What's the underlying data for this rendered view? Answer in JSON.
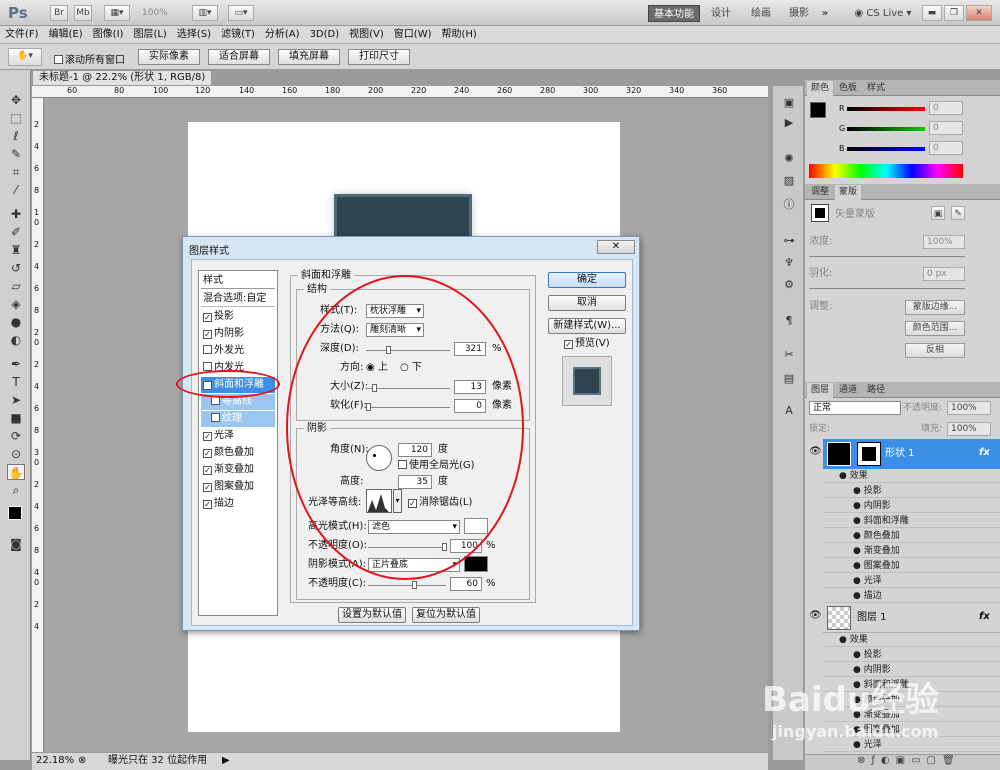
{
  "app": {
    "logo": "Ps",
    "zoom_box": "100%"
  },
  "workspace": {
    "items": [
      "基本功能",
      "设计",
      "绘画",
      "摄影"
    ],
    "more": "»",
    "cslive": "CS Live"
  },
  "menu": [
    "文件(F)",
    "编辑(E)",
    "图像(I)",
    "图层(L)",
    "选择(S)",
    "滤镜(T)",
    "分析(A)",
    "3D(D)",
    "视图(V)",
    "窗口(W)",
    "帮助(H)"
  ],
  "options": {
    "scroll_all": "滚动所有窗口",
    "buttons": [
      "实际像素",
      "适合屏幕",
      "填充屏幕",
      "打印尺寸"
    ]
  },
  "document": {
    "tab": "未标题-1 @ 22.2% (形状 1, RGB/8) *",
    "ruler_h": [
      "60",
      "80",
      "100",
      "120",
      "140",
      "160",
      "180",
      "200",
      "220",
      "240",
      "260",
      "280",
      "300",
      "320",
      "340",
      "360"
    ],
    "ruler_v": [
      "2",
      "4",
      "6",
      "8",
      "1",
      "0",
      "2",
      "4",
      "6",
      "8",
      "2",
      "0",
      "2",
      "4",
      "6",
      "8",
      "3",
      "0",
      "2",
      "4",
      "6",
      "8",
      "4",
      "0",
      "2",
      "4"
    ]
  },
  "status": {
    "zoom": "22.18%",
    "msg": "曝光只在 32 位起作用"
  },
  "color_panel": {
    "tabs": [
      "颜色",
      "色板",
      "样式"
    ],
    "labels": [
      "R",
      "G",
      "B"
    ],
    "values": [
      "0",
      "0",
      "0"
    ]
  },
  "adjust_panel": {
    "tabs": [
      "调整",
      "蒙版"
    ],
    "title": "矢量蒙版",
    "density_label": "浓度:",
    "density": "100%",
    "feather_label": "羽化:",
    "feather": "0 px",
    "adjust_label": "调整:",
    "buttons": [
      "蒙版边缘...",
      "颜色范围...",
      "反相"
    ]
  },
  "layers_panel": {
    "tabs": [
      "图层",
      "通道",
      "路径"
    ],
    "blend": "正常",
    "opacity_label": "不透明度:",
    "opacity": "100%",
    "lock_label": "锁定:",
    "fill_label": "填充:",
    "fill": "100%",
    "layer1_name": "形状 1",
    "layer2_name": "图层 1",
    "effects_label": "效果",
    "effects1": [
      "投影",
      "内阴影",
      "斜面和浮雕",
      "颜色叠加",
      "渐变叠加",
      "图案叠加",
      "光泽",
      "描边"
    ],
    "effects2": [
      "投影",
      "内阴影",
      "斜面和浮雕",
      "颜色叠加",
      "渐变叠加",
      "图案叠加",
      "光泽"
    ]
  },
  "dialog": {
    "title": "图层样式",
    "styles_header": "样式",
    "blend_options": "混合选项:自定",
    "styles": [
      {
        "label": "投影",
        "checked": true
      },
      {
        "label": "内阴影",
        "checked": true
      },
      {
        "label": "外发光",
        "checked": false
      },
      {
        "label": "内发光",
        "checked": false
      },
      {
        "label": "斜面和浮雕",
        "checked": true
      },
      {
        "label": "等高线",
        "checked": false
      },
      {
        "label": "纹理",
        "checked": false
      },
      {
        "label": "光泽",
        "checked": true
      },
      {
        "label": "颜色叠加",
        "checked": true
      },
      {
        "label": "渐变叠加",
        "checked": true
      },
      {
        "label": "图案叠加",
        "checked": true
      },
      {
        "label": "描边",
        "checked": true
      }
    ],
    "section_title": "斜面和浮雕",
    "structure": {
      "title": "结构",
      "style_label": "样式(T):",
      "style": "枕状浮雕",
      "method_label": "方法(Q):",
      "method": "雕刻清晰",
      "depth_label": "深度(D):",
      "depth": "321",
      "depth_unit": "%",
      "direction_label": "方向:",
      "dir_up": "上",
      "dir_down": "下",
      "size_label": "大小(Z):",
      "size": "13",
      "size_unit": "像素",
      "soften_label": "软化(F):",
      "soften": "0",
      "soften_unit": "像素"
    },
    "shading": {
      "title": "阴影",
      "angle_label": "角度(N):",
      "angle": "120",
      "angle_unit": "度",
      "global_light": "使用全局光(G)",
      "altitude_label": "高度:",
      "altitude": "35",
      "altitude_unit": "度",
      "gloss_label": "光泽等高线:",
      "antialias": "消除锯齿(L)",
      "highlight_label": "高光模式(H):",
      "highlight_mode": "滤色",
      "hl_opacity_label": "不透明度(O):",
      "hl_opacity": "100",
      "pct": "%",
      "shadow_label": "阴影模式(A):",
      "shadow_mode": "正片叠底",
      "sh_opacity_label": "不透明度(C):",
      "sh_opacity": "60"
    },
    "buttons": {
      "ok": "确定",
      "cancel": "取消",
      "new_style": "新建样式(W)...",
      "preview": "预览(V)",
      "make_default": "设置为默认值",
      "reset_default": "复位为默认值"
    }
  },
  "watermark": {
    "text": "Baidu经验",
    "sub": "jingyan.baidu.com"
  }
}
